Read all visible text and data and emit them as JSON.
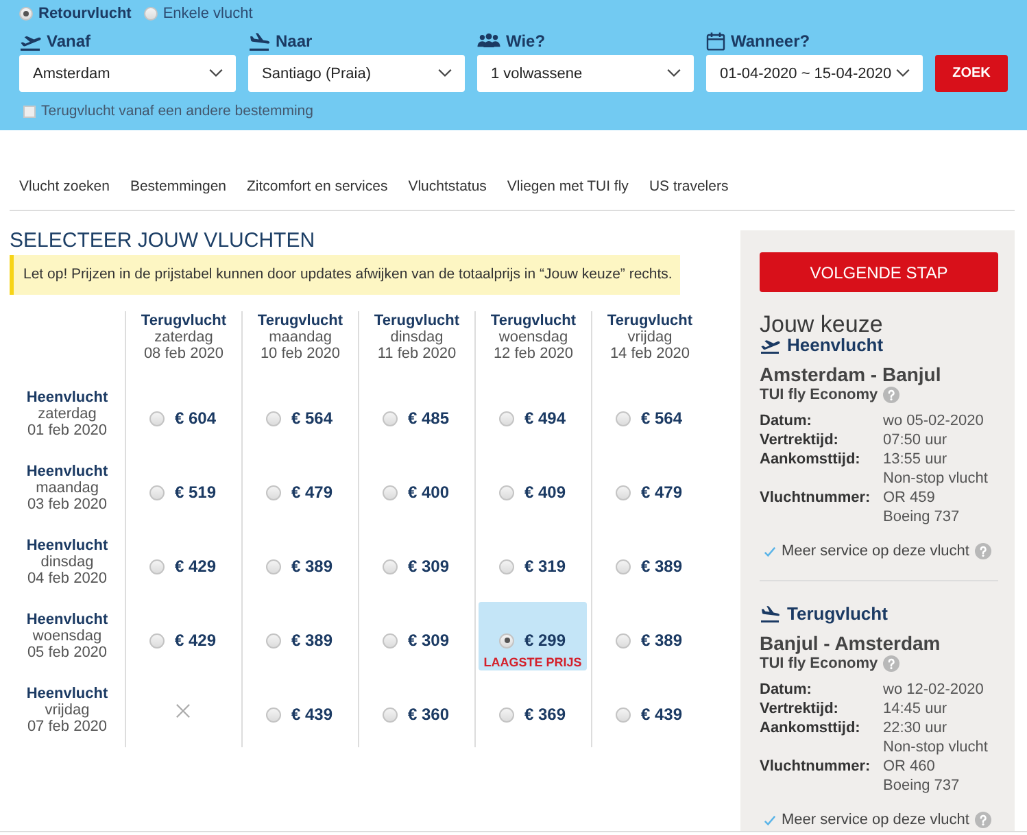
{
  "trip_types": [
    {
      "label": "Retourvlucht",
      "selected": true
    },
    {
      "label": "Enkele vlucht",
      "selected": false
    }
  ],
  "search": {
    "fields": [
      {
        "kind": "departure",
        "label": "Vanaf",
        "value": "Amsterdam"
      },
      {
        "kind": "arrival",
        "label": "Naar",
        "value": "Santiago (Praia)"
      },
      {
        "kind": "travellers",
        "label": "Wie?",
        "value": "1 volwassene"
      },
      {
        "kind": "dates",
        "label": "Wanneer?",
        "value": "01-04-2020 ~ 15-04-2020"
      }
    ],
    "button": "ZOEK",
    "other_return": {
      "label": "Terugvlucht vanaf een andere bestemming",
      "checked": false
    }
  },
  "nav": [
    "Vlucht zoeken",
    "Bestemmingen",
    "Zitcomfort en services",
    "Vluchtstatus",
    "Vliegen met TUI fly",
    "US travelers"
  ],
  "title": "SELECTEER JOUW VLUCHTEN",
  "notice": "Let op! Prijzen in de prijstabel kunnen door updates afwijken van de totaalprijs in “Jouw keuze” rechts.",
  "price_table": {
    "columns": [
      {
        "label": "Terugvlucht",
        "day": "zaterdag",
        "date": "08 feb 2020"
      },
      {
        "label": "Terugvlucht",
        "day": "maandag",
        "date": "10 feb 2020"
      },
      {
        "label": "Terugvlucht",
        "day": "dinsdag",
        "date": "11 feb 2020"
      },
      {
        "label": "Terugvlucht",
        "day": "woensdag",
        "date": "12 feb 2020"
      },
      {
        "label": "Terugvlucht",
        "day": "vrijdag",
        "date": "14 feb 2020"
      }
    ],
    "rows": [
      {
        "label": "Heenvlucht",
        "day": "zaterdag",
        "date": "01 feb 2020",
        "cells": [
          {
            "kind": "fare",
            "price": "€ 604",
            "selected": false
          },
          {
            "kind": "fare",
            "price": "€ 564",
            "selected": false
          },
          {
            "kind": "fare",
            "price": "€ 485",
            "selected": false
          },
          {
            "kind": "fare",
            "price": "€ 494",
            "selected": false
          },
          {
            "kind": "fare",
            "price": "€ 564",
            "selected": false
          }
        ]
      },
      {
        "label": "Heenvlucht",
        "day": "maandag",
        "date": "03 feb 2020",
        "cells": [
          {
            "kind": "fare",
            "price": "€ 519",
            "selected": false
          },
          {
            "kind": "fare",
            "price": "€ 479",
            "selected": false
          },
          {
            "kind": "fare",
            "price": "€ 400",
            "selected": false
          },
          {
            "kind": "fare",
            "price": "€ 409",
            "selected": false
          },
          {
            "kind": "fare",
            "price": "€ 479",
            "selected": false
          }
        ]
      },
      {
        "label": "Heenvlucht",
        "day": "dinsdag",
        "date": "04 feb 2020",
        "cells": [
          {
            "kind": "fare",
            "price": "€ 429",
            "selected": false
          },
          {
            "kind": "fare",
            "price": "€ 389",
            "selected": false
          },
          {
            "kind": "fare",
            "price": "€ 309",
            "selected": false
          },
          {
            "kind": "fare",
            "price": "€ 319",
            "selected": false
          },
          {
            "kind": "fare",
            "price": "€ 389",
            "selected": false
          }
        ]
      },
      {
        "label": "Heenvlucht",
        "day": "woensdag",
        "date": "05 feb 2020",
        "cells": [
          {
            "kind": "fare",
            "price": "€ 429",
            "selected": false
          },
          {
            "kind": "fare",
            "price": "€ 389",
            "selected": false
          },
          {
            "kind": "fare",
            "price": "€ 309",
            "selected": false
          },
          {
            "kind": "fare",
            "price": "€ 299",
            "selected": true,
            "badge": "LAAGSTE PRIJS"
          },
          {
            "kind": "fare",
            "price": "€ 389",
            "selected": false
          }
        ]
      },
      {
        "label": "Heenvlucht",
        "day": "vrijdag",
        "date": "07 feb 2020",
        "cells": [
          {
            "kind": "unavailable"
          },
          {
            "kind": "fare",
            "price": "€ 439",
            "selected": false
          },
          {
            "kind": "fare",
            "price": "€ 360",
            "selected": false
          },
          {
            "kind": "fare",
            "price": "€ 369",
            "selected": false
          },
          {
            "kind": "fare",
            "price": "€ 439",
            "selected": false
          }
        ]
      }
    ]
  },
  "summary": {
    "button": "VOLGENDE STAP",
    "title": "Jouw keuze",
    "flights": [
      {
        "kind": "outbound",
        "label": "Heenvlucht",
        "route": "Amsterdam - Banjul",
        "fare": "TUI fly Economy",
        "details": [
          {
            "label": "Datum:",
            "value": "wo 05-02-2020"
          },
          {
            "label": "Vertrektijd:",
            "value": "07:50 uur"
          },
          {
            "label": "Aankomsttijd:",
            "value": "13:55 uur"
          },
          {
            "value": "Non-stop vlucht"
          },
          {
            "label": "Vluchtnummer:",
            "value": "OR 459"
          },
          {
            "value": "Boeing 737"
          }
        ],
        "service_link": "Meer service op deze vlucht"
      },
      {
        "kind": "return",
        "label": "Terugvlucht",
        "route": "Banjul - Amsterdam",
        "fare": "TUI fly Economy",
        "details": [
          {
            "label": "Datum:",
            "value": "wo 12-02-2020"
          },
          {
            "label": "Vertrektijd:",
            "value": "14:45 uur"
          },
          {
            "label": "Aankomsttijd:",
            "value": "22:30 uur"
          },
          {
            "value": "Non-stop vlucht"
          },
          {
            "label": "Vluchtnummer:",
            "value": "OR 460"
          },
          {
            "value": "Boeing 737"
          }
        ],
        "service_link": "Meer service op deze vlucht"
      }
    ]
  }
}
